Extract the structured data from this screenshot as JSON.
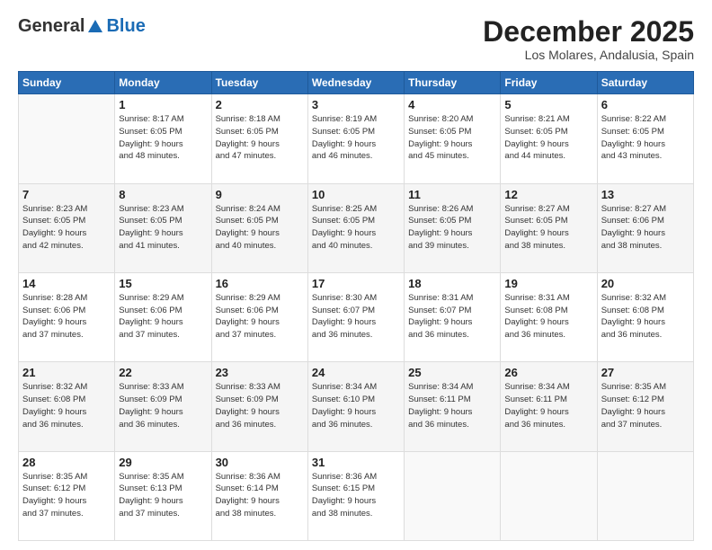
{
  "header": {
    "logo_general": "General",
    "logo_blue": "Blue",
    "month_title": "December 2025",
    "location": "Los Molares, Andalusia, Spain"
  },
  "days_of_week": [
    "Sunday",
    "Monday",
    "Tuesday",
    "Wednesday",
    "Thursday",
    "Friday",
    "Saturday"
  ],
  "weeks": [
    [
      {
        "day": "",
        "info": ""
      },
      {
        "day": "1",
        "info": "Sunrise: 8:17 AM\nSunset: 6:05 PM\nDaylight: 9 hours\nand 48 minutes."
      },
      {
        "day": "2",
        "info": "Sunrise: 8:18 AM\nSunset: 6:05 PM\nDaylight: 9 hours\nand 47 minutes."
      },
      {
        "day": "3",
        "info": "Sunrise: 8:19 AM\nSunset: 6:05 PM\nDaylight: 9 hours\nand 46 minutes."
      },
      {
        "day": "4",
        "info": "Sunrise: 8:20 AM\nSunset: 6:05 PM\nDaylight: 9 hours\nand 45 minutes."
      },
      {
        "day": "5",
        "info": "Sunrise: 8:21 AM\nSunset: 6:05 PM\nDaylight: 9 hours\nand 44 minutes."
      },
      {
        "day": "6",
        "info": "Sunrise: 8:22 AM\nSunset: 6:05 PM\nDaylight: 9 hours\nand 43 minutes."
      }
    ],
    [
      {
        "day": "7",
        "info": "Sunrise: 8:23 AM\nSunset: 6:05 PM\nDaylight: 9 hours\nand 42 minutes."
      },
      {
        "day": "8",
        "info": "Sunrise: 8:23 AM\nSunset: 6:05 PM\nDaylight: 9 hours\nand 41 minutes."
      },
      {
        "day": "9",
        "info": "Sunrise: 8:24 AM\nSunset: 6:05 PM\nDaylight: 9 hours\nand 40 minutes."
      },
      {
        "day": "10",
        "info": "Sunrise: 8:25 AM\nSunset: 6:05 PM\nDaylight: 9 hours\nand 40 minutes."
      },
      {
        "day": "11",
        "info": "Sunrise: 8:26 AM\nSunset: 6:05 PM\nDaylight: 9 hours\nand 39 minutes."
      },
      {
        "day": "12",
        "info": "Sunrise: 8:27 AM\nSunset: 6:05 PM\nDaylight: 9 hours\nand 38 minutes."
      },
      {
        "day": "13",
        "info": "Sunrise: 8:27 AM\nSunset: 6:06 PM\nDaylight: 9 hours\nand 38 minutes."
      }
    ],
    [
      {
        "day": "14",
        "info": "Sunrise: 8:28 AM\nSunset: 6:06 PM\nDaylight: 9 hours\nand 37 minutes."
      },
      {
        "day": "15",
        "info": "Sunrise: 8:29 AM\nSunset: 6:06 PM\nDaylight: 9 hours\nand 37 minutes."
      },
      {
        "day": "16",
        "info": "Sunrise: 8:29 AM\nSunset: 6:06 PM\nDaylight: 9 hours\nand 37 minutes."
      },
      {
        "day": "17",
        "info": "Sunrise: 8:30 AM\nSunset: 6:07 PM\nDaylight: 9 hours\nand 36 minutes."
      },
      {
        "day": "18",
        "info": "Sunrise: 8:31 AM\nSunset: 6:07 PM\nDaylight: 9 hours\nand 36 minutes."
      },
      {
        "day": "19",
        "info": "Sunrise: 8:31 AM\nSunset: 6:08 PM\nDaylight: 9 hours\nand 36 minutes."
      },
      {
        "day": "20",
        "info": "Sunrise: 8:32 AM\nSunset: 6:08 PM\nDaylight: 9 hours\nand 36 minutes."
      }
    ],
    [
      {
        "day": "21",
        "info": "Sunrise: 8:32 AM\nSunset: 6:08 PM\nDaylight: 9 hours\nand 36 minutes."
      },
      {
        "day": "22",
        "info": "Sunrise: 8:33 AM\nSunset: 6:09 PM\nDaylight: 9 hours\nand 36 minutes."
      },
      {
        "day": "23",
        "info": "Sunrise: 8:33 AM\nSunset: 6:09 PM\nDaylight: 9 hours\nand 36 minutes."
      },
      {
        "day": "24",
        "info": "Sunrise: 8:34 AM\nSunset: 6:10 PM\nDaylight: 9 hours\nand 36 minutes."
      },
      {
        "day": "25",
        "info": "Sunrise: 8:34 AM\nSunset: 6:11 PM\nDaylight: 9 hours\nand 36 minutes."
      },
      {
        "day": "26",
        "info": "Sunrise: 8:34 AM\nSunset: 6:11 PM\nDaylight: 9 hours\nand 36 minutes."
      },
      {
        "day": "27",
        "info": "Sunrise: 8:35 AM\nSunset: 6:12 PM\nDaylight: 9 hours\nand 37 minutes."
      }
    ],
    [
      {
        "day": "28",
        "info": "Sunrise: 8:35 AM\nSunset: 6:12 PM\nDaylight: 9 hours\nand 37 minutes."
      },
      {
        "day": "29",
        "info": "Sunrise: 8:35 AM\nSunset: 6:13 PM\nDaylight: 9 hours\nand 37 minutes."
      },
      {
        "day": "30",
        "info": "Sunrise: 8:36 AM\nSunset: 6:14 PM\nDaylight: 9 hours\nand 38 minutes."
      },
      {
        "day": "31",
        "info": "Sunrise: 8:36 AM\nSunset: 6:15 PM\nDaylight: 9 hours\nand 38 minutes."
      },
      {
        "day": "",
        "info": ""
      },
      {
        "day": "",
        "info": ""
      },
      {
        "day": "",
        "info": ""
      }
    ]
  ]
}
